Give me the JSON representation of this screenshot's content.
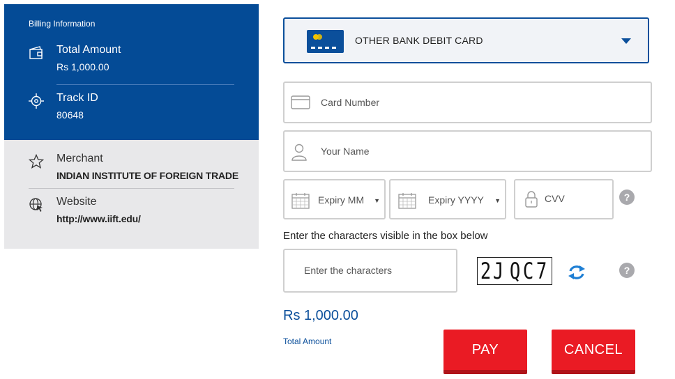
{
  "billing": {
    "title": "Billing Information",
    "total_amount_label": "Total Amount",
    "total_amount_value": "Rs 1,000.00",
    "track_id_label": "Track ID",
    "track_id_value": "80648"
  },
  "merchant": {
    "merchant_label": "Merchant",
    "merchant_value": "INDIAN INSTITUTE OF FOREIGN TRADE",
    "website_label": "Website",
    "website_value": "http://www.iift.edu/"
  },
  "payment": {
    "card_type": "OTHER BANK DEBIT CARD",
    "card_number_placeholder": "Card Number",
    "name_placeholder": "Your Name",
    "expiry_mm_placeholder": "Expiry MM",
    "expiry_yyyy_placeholder": "Expiry YYYY",
    "cvv_placeholder": "CVV",
    "help_symbol": "?",
    "captcha_instruction": "Enter the characters visible in the box below",
    "captcha_placeholder": "Enter the characters",
    "captcha_text": [
      "2",
      "J",
      "Q",
      "C",
      "7"
    ],
    "amount": "Rs 1,000.00",
    "amount_label": "Total Amount",
    "pay_label": "PAY",
    "cancel_label": "CANCEL"
  },
  "colors": {
    "brand_blue": "#044b96",
    "panel_gray": "#e8e8ea",
    "button_red": "#ea1b24",
    "help_gray": "#a9a9ad"
  }
}
